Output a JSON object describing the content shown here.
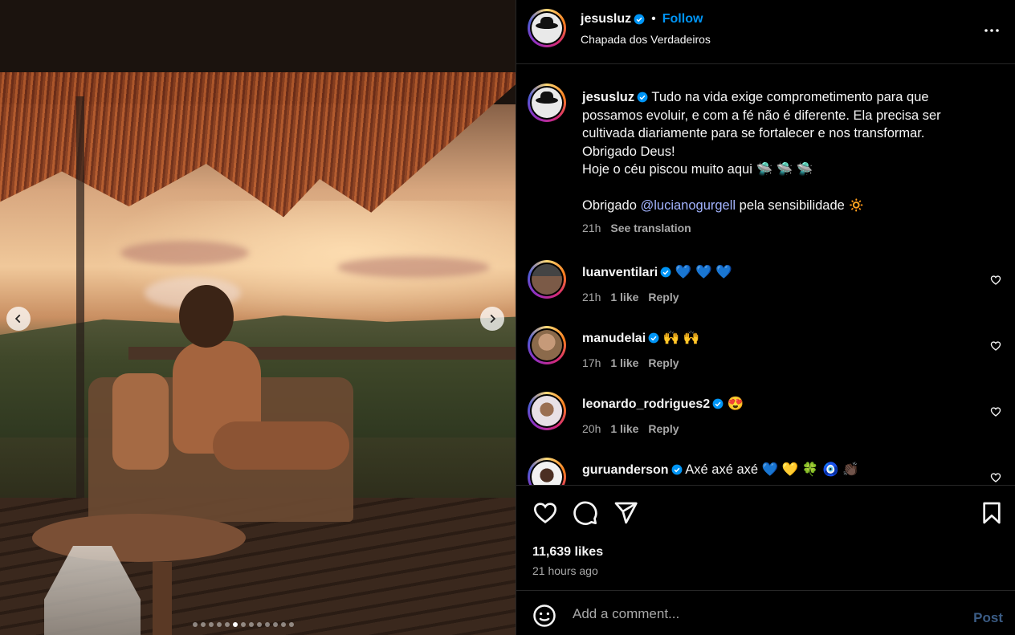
{
  "post": {
    "author": "jesusluz",
    "separator": "•",
    "follow_label": "Follow",
    "location": "Chapada dos Verdadeiros",
    "caption": {
      "line1": "Tudo na vida exige comprometimento para que possamos evoluir, e com a fé não é diferente. Ela precisa ser cultivada diariamente para se fortalecer e nos transformar.",
      "line2": "Obrigado Deus!",
      "line3": "Hoje o céu piscou muito aqui 🛸 🛸 🛸",
      "thanks_prefix": "Obrigado",
      "mention": "@lucianogurgell",
      "thanks_suffix": "pela sensibilidade 🔅",
      "age": "21h",
      "translate_label": "See translation"
    },
    "carousel": {
      "count": 13,
      "active_index": 5
    }
  },
  "comments": [
    {
      "user": "luanventilari",
      "text": "💙 💙 💙",
      "age": "21h",
      "likes": "1 like",
      "reply": "Reply"
    },
    {
      "user": "manudelai",
      "text": "🙌 🙌",
      "age": "17h",
      "likes": "1 like",
      "reply": "Reply"
    },
    {
      "user": "leonardo_rodrigues2",
      "text": "😍",
      "age": "20h",
      "likes": "1 like",
      "reply": "Reply"
    },
    {
      "user": "guruanderson",
      "text": "Axé axé axé 💙 💛 🍀 🧿 👏🏿",
      "age": "",
      "likes": "",
      "reply": ""
    }
  ],
  "stats": {
    "likes": "11,639 likes",
    "posted": "21 hours ago"
  },
  "composer": {
    "placeholder": "Add a comment...",
    "post_label": "Post"
  },
  "colors": {
    "accent": "#0095f6",
    "mention": "#a3b4ff",
    "muted": "#a8a8a8",
    "background": "#000000"
  }
}
